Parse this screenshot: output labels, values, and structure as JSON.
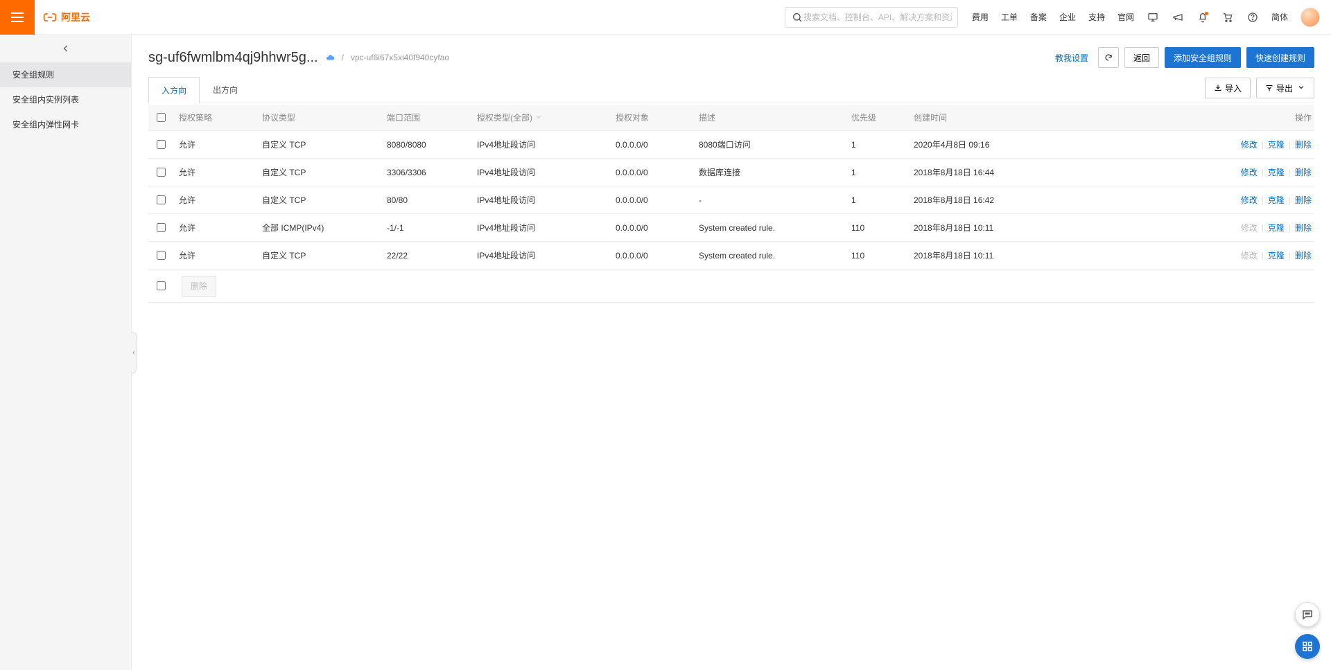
{
  "topbar": {
    "brand_text": "阿里云",
    "search_placeholder": "搜索文档、控制台、API、解决方案和资源",
    "links": [
      "费用",
      "工单",
      "备案",
      "企业",
      "支持",
      "官网"
    ],
    "lang": "简体"
  },
  "sidebar": {
    "items": [
      {
        "label": "安全组规则",
        "active": true
      },
      {
        "label": "安全组内实例列表",
        "active": false
      },
      {
        "label": "安全组内弹性网卡",
        "active": false
      }
    ]
  },
  "page": {
    "title": "sg-uf6fwmlbm4qj9hhwr5g...",
    "breadcrumb_sep": "/",
    "breadcrumb_vpc": "vpc-uf6i67x5xi40f940cyfao"
  },
  "head_actions": {
    "teach": "教我设置",
    "back": "返回",
    "add_rule": "添加安全组规则",
    "quick_rule": "快速创建规则"
  },
  "tabs": {
    "in": "入方向",
    "out": "出方向",
    "import": "导入",
    "export": "导出"
  },
  "table": {
    "head": {
      "policy": "授权策略",
      "protocol": "协议类型",
      "port": "端口范围",
      "auth_type": "授权类型(全部)",
      "auth_obj": "授权对象",
      "desc": "描述",
      "priority": "优先级",
      "ctime": "创建时间",
      "ops": "操作"
    },
    "ops_labels": {
      "edit": "修改",
      "clone": "克隆",
      "delete": "删除"
    },
    "bulk_delete": "删除",
    "rows": [
      {
        "policy": "允许",
        "protocol": "自定义 TCP",
        "port": "8080/8080",
        "auth_type": "IPv4地址段访问",
        "auth_obj": "0.0.0.0/0",
        "desc": "8080端口访问",
        "priority": "1",
        "ctime": "2020年4月8日 09:16",
        "edit_disabled": false
      },
      {
        "policy": "允许",
        "protocol": "自定义 TCP",
        "port": "3306/3306",
        "auth_type": "IPv4地址段访问",
        "auth_obj": "0.0.0.0/0",
        "desc": "数据库连接",
        "priority": "1",
        "ctime": "2018年8月18日 16:44",
        "edit_disabled": false
      },
      {
        "policy": "允许",
        "protocol": "自定义 TCP",
        "port": "80/80",
        "auth_type": "IPv4地址段访问",
        "auth_obj": "0.0.0.0/0",
        "desc": "-",
        "priority": "1",
        "ctime": "2018年8月18日 16:42",
        "edit_disabled": false
      },
      {
        "policy": "允许",
        "protocol": "全部 ICMP(IPv4)",
        "port": "-1/-1",
        "auth_type": "IPv4地址段访问",
        "auth_obj": "0.0.0.0/0",
        "desc": "System created rule.",
        "priority": "110",
        "ctime": "2018年8月18日 10:11",
        "edit_disabled": true
      },
      {
        "policy": "允许",
        "protocol": "自定义 TCP",
        "port": "22/22",
        "auth_type": "IPv4地址段访问",
        "auth_obj": "0.0.0.0/0",
        "desc": "System created rule.",
        "priority": "110",
        "ctime": "2018年8月18日 10:11",
        "edit_disabled": true
      }
    ]
  }
}
